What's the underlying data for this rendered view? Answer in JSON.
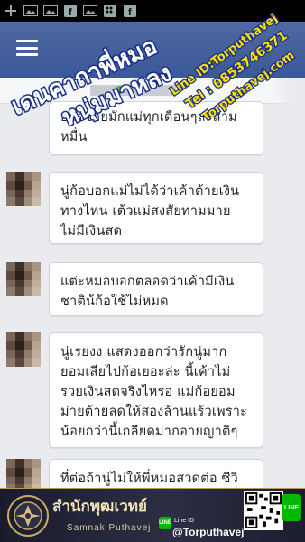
{
  "status_bar": {
    "icons": [
      "plus-icon",
      "image-icon",
      "image-icon",
      "facebook-icon",
      "image-icon",
      "bbm-icon",
      "facebook-icon"
    ]
  },
  "app_bar": {
    "menu_icon": "hamburger-icon",
    "accent": "#3b5998"
  },
  "messages": [
    {
      "text": "อมจ๋จ่ายมักแม่ทุกเดือนๆละสาม หมื่น"
    },
    {
      "text": "นู่ก้อบอกแม่ไม่ได้ว่าเค้าต้ายเงิน ทางไหน เต้วแม่สงสัยทามมาย ไม่มีเงินสด"
    },
    {
      "text": "แต่ะหมอบอกตลอดว่าเค้ามีเงิน ชาติน้ก้อใช้ไม่หมด"
    },
    {
      "text": "นู่เรยงง แสดงออกว่ารักนู่มาก ยอมเสียไปก้อเยอะล่ะ นี้เค้าไม่ รวยเงินสดจริงไหรอ  แม่ก้อยอม ม่ายต้ายลดให้สองล้านแร้วเพราะ น้อยกว่านี้เกลียดมากอายญาติๆ"
    },
    {
      "text": "ที่ต่อถ้านู่ไม่ให้พี่หมอสวดต่อ ซีวิ"
    }
  ],
  "watermark": {
    "title_line1": "เดนคาถาพี่หมอ",
    "title_line2": "หนุ่มมาหลง",
    "side_line1": "Line ID:Torputhavej",
    "side_line2": "Tel : 0853746371",
    "side_line3": "Torputhavej.com"
  },
  "footer": {
    "brand_thai": "สำนักพุฒเวทย์",
    "brand_en": "Samnak Puthavej",
    "line_label": "Line ID",
    "line_id": "@Torputhavej",
    "line_badge": "LINE",
    "line_icon_label": "LINE",
    "colors": {
      "background": "#22243a",
      "gold": "#b8975a"
    }
  }
}
